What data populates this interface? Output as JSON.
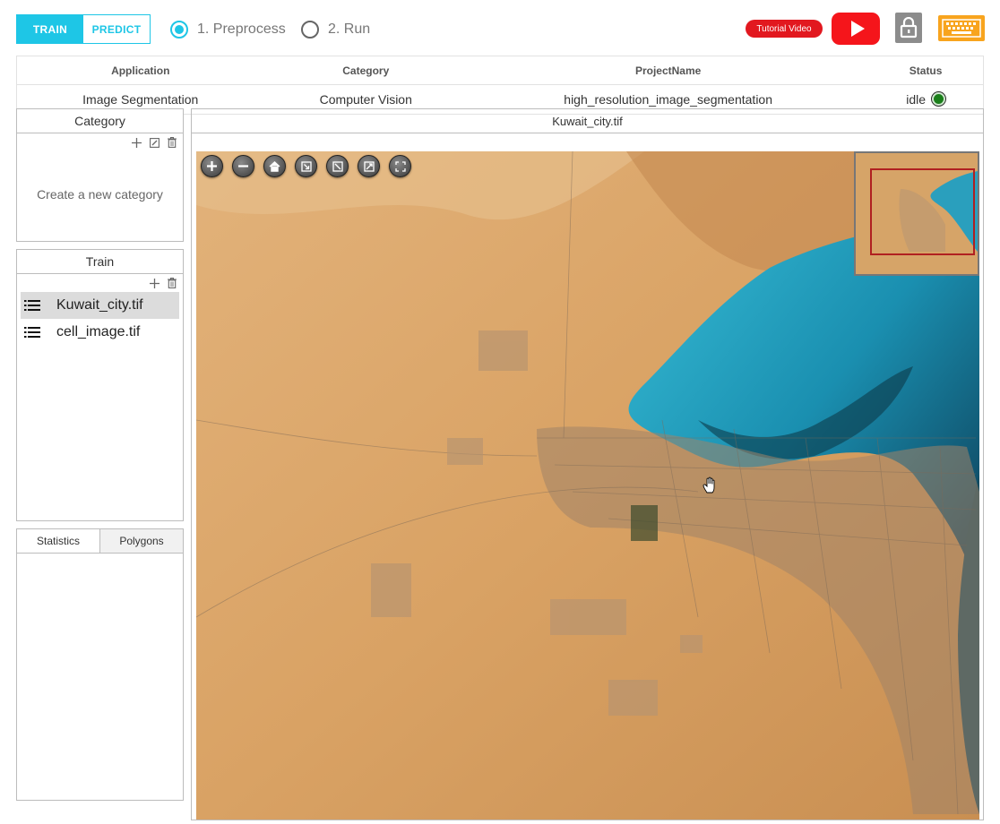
{
  "mode": {
    "train": "TRAIN",
    "predict": "PREDICT",
    "active": "train"
  },
  "steps": [
    {
      "label": "1. Preprocess",
      "checked": true
    },
    {
      "label": "2. Run",
      "checked": false
    }
  ],
  "header_actions": {
    "tutorial": "Tutorial Video"
  },
  "project": {
    "headers": [
      "Application",
      "Category",
      "ProjectName",
      "Status"
    ],
    "application": "Image Segmentation",
    "category": "Computer Vision",
    "project_name": "high_resolution_image_segmentation",
    "status": "idle",
    "status_color": "#1b7f1b"
  },
  "category_panel": {
    "title": "Category",
    "empty_hint": "Create a new category"
  },
  "train_panel": {
    "title": "Train",
    "files": [
      "Kuwait_city.tif",
      "cell_image.tif"
    ],
    "selected": "Kuwait_city.tif"
  },
  "stats_panel": {
    "tabs": [
      "Statistics",
      "Polygons"
    ],
    "active_tab": "Statistics"
  },
  "viewer": {
    "title": "Kuwait_city.tif",
    "controls": [
      "zoom-in-icon",
      "zoom-out-icon",
      "home-icon",
      "fit-icon",
      "draw-icon",
      "edit-icon",
      "fullscreen-icon"
    ]
  },
  "colors": {
    "accent": "#1ec6e6",
    "youtube": "#f5151b",
    "keyboard": "#f8a41e",
    "sand": "#d9a060",
    "sea": "#1fa6c4"
  }
}
